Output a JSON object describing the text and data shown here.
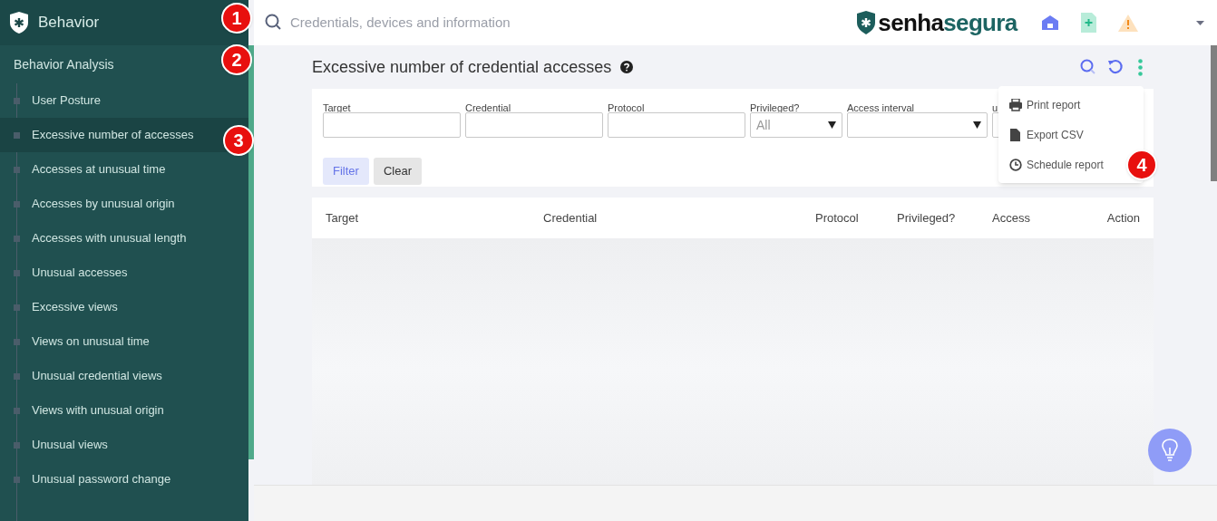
{
  "sidebar": {
    "title": "Behavior",
    "section": "Behavior Analysis",
    "items": [
      {
        "label": "User Posture",
        "selected": false
      },
      {
        "label": "Excessive number of accesses",
        "selected": true
      },
      {
        "label": "Accesses at unusual time",
        "selected": false
      },
      {
        "label": "Accesses by unusual origin",
        "selected": false
      },
      {
        "label": "Accesses with unusual length",
        "selected": false
      },
      {
        "label": "Unusual accesses",
        "selected": false
      },
      {
        "label": "Excessive views",
        "selected": false
      },
      {
        "label": "Views on unusual time",
        "selected": false
      },
      {
        "label": "Unusual credential views",
        "selected": false
      },
      {
        "label": "Views with unusual origin",
        "selected": false
      },
      {
        "label": "Unusual views",
        "selected": false
      },
      {
        "label": "Unusual password change",
        "selected": false
      }
    ]
  },
  "topbar": {
    "search_placeholder": "Credentials, devices and information",
    "brand": [
      "senha",
      "segura"
    ]
  },
  "page": {
    "title": "Excessive number of credential accesses",
    "filters": [
      {
        "label": "Target",
        "kind": "text"
      },
      {
        "label": "Credential",
        "kind": "text"
      },
      {
        "label": "Protocol",
        "kind": "text"
      },
      {
        "label": "Privileged?",
        "kind": "select",
        "value": "All"
      },
      {
        "label": "Access interval",
        "kind": "select"
      },
      {
        "label": "u",
        "kind": "text"
      }
    ],
    "buttons": [
      {
        "label": "Filter",
        "kind": "primary"
      },
      {
        "label": "Clear",
        "kind": "secondary"
      }
    ],
    "menu": [
      {
        "label": "Print report",
        "kind": "print"
      },
      {
        "label": "Export CSV",
        "kind": "export"
      },
      {
        "label": "Schedule report",
        "kind": "schedule"
      }
    ],
    "table": {
      "columns": [
        "Target",
        "Credential",
        "Protocol",
        "Privileged?",
        "Access",
        "Action"
      ]
    }
  },
  "callouts": [
    "1",
    "2",
    "3",
    "4"
  ]
}
